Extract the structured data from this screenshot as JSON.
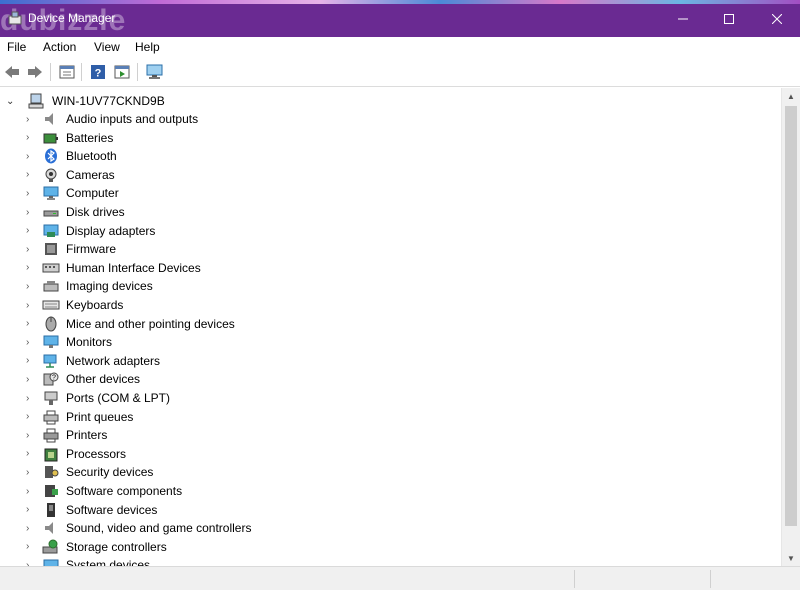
{
  "window": {
    "title": "Device Manager",
    "watermark": "dubizzle",
    "title_bar_color": "#6a2a92"
  },
  "menu": [
    "File",
    "Action",
    "View",
    "Help"
  ],
  "toolbar": [
    "back-icon",
    "forward-icon",
    "properties-icon",
    "help-icon",
    "update-driver-icon",
    "scan-hardware-icon"
  ],
  "tree": {
    "root_label": "WIN-1UV77CKND9B",
    "categories": [
      {
        "label": "Audio inputs and outputs",
        "icon": "speaker-icon"
      },
      {
        "label": "Batteries",
        "icon": "battery-icon"
      },
      {
        "label": "Bluetooth",
        "icon": "bluetooth-icon"
      },
      {
        "label": "Cameras",
        "icon": "camera-icon"
      },
      {
        "label": "Computer",
        "icon": "computer-icon"
      },
      {
        "label": "Disk drives",
        "icon": "disk-drive-icon"
      },
      {
        "label": "Display adapters",
        "icon": "display-adapter-icon"
      },
      {
        "label": "Firmware",
        "icon": "firmware-icon"
      },
      {
        "label": "Human Interface Devices",
        "icon": "hid-icon"
      },
      {
        "label": "Imaging devices",
        "icon": "imaging-icon"
      },
      {
        "label": "Keyboards",
        "icon": "keyboard-icon"
      },
      {
        "label": "Mice and other pointing devices",
        "icon": "mouse-icon"
      },
      {
        "label": "Monitors",
        "icon": "monitor-icon"
      },
      {
        "label": "Network adapters",
        "icon": "network-icon"
      },
      {
        "label": "Other devices",
        "icon": "unknown-device-icon"
      },
      {
        "label": "Ports (COM & LPT)",
        "icon": "port-icon"
      },
      {
        "label": "Print queues",
        "icon": "print-queue-icon"
      },
      {
        "label": "Printers",
        "icon": "printer-icon"
      },
      {
        "label": "Processors",
        "icon": "processor-icon"
      },
      {
        "label": "Security devices",
        "icon": "security-icon"
      },
      {
        "label": "Software components",
        "icon": "software-component-icon"
      },
      {
        "label": "Software devices",
        "icon": "software-device-icon"
      },
      {
        "label": "Sound, video and game controllers",
        "icon": "sound-icon"
      },
      {
        "label": "Storage controllers",
        "icon": "storage-icon"
      },
      {
        "label": "System devices",
        "icon": "system-icon"
      }
    ]
  }
}
